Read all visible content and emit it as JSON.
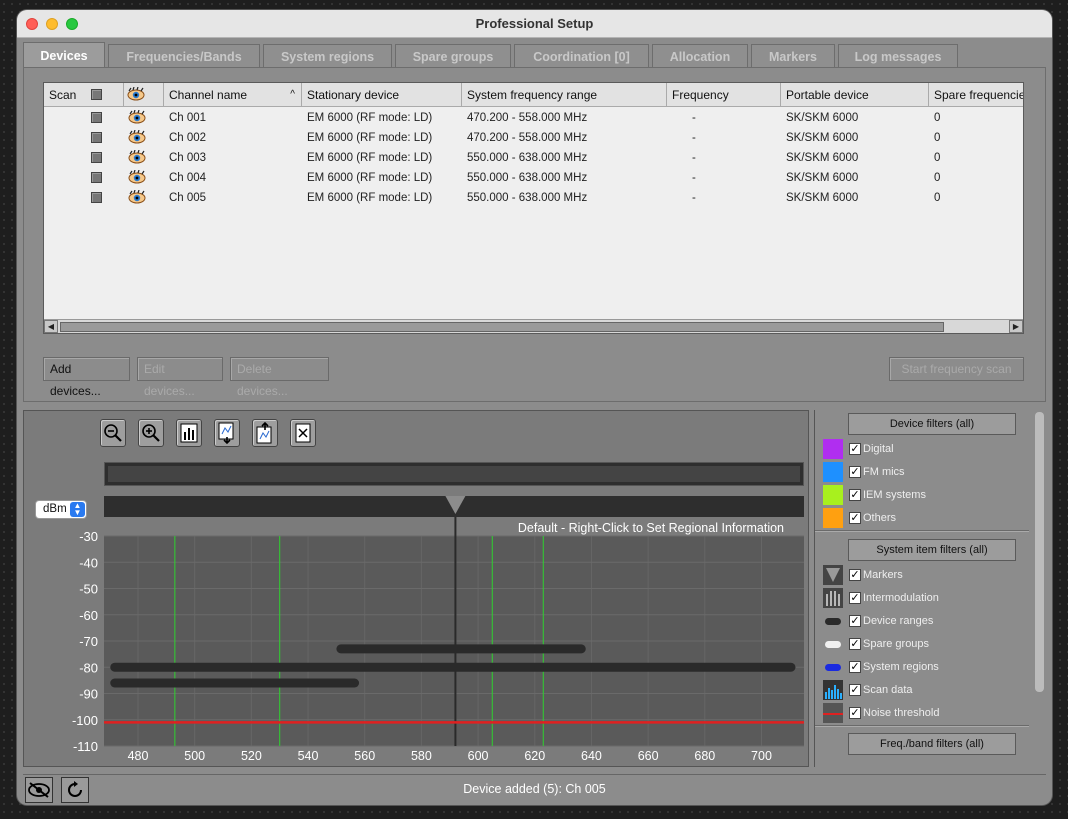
{
  "window": {
    "title": "Professional Setup"
  },
  "tabs": [
    {
      "label": "Devices"
    },
    {
      "label": "Frequencies/Bands"
    },
    {
      "label": "System regions"
    },
    {
      "label": "Spare groups"
    },
    {
      "label": "Coordination [0]"
    },
    {
      "label": "Allocation"
    },
    {
      "label": "Markers"
    },
    {
      "label": "Log messages"
    }
  ],
  "table": {
    "columns": [
      {
        "label": "Scan"
      },
      {
        "label": ""
      },
      {
        "label": "Channel name",
        "sort": "ascending"
      },
      {
        "label": "Stationary device"
      },
      {
        "label": "System frequency range"
      },
      {
        "label": "Frequency"
      },
      {
        "label": "Portable device"
      },
      {
        "label": "Spare frequencie"
      }
    ],
    "rows": [
      {
        "channel": "Ch 001",
        "stationary": "EM 6000 (RF mode: LD)",
        "range": "470.200 - 558.000 MHz",
        "frequency": "-",
        "portable": "SK/SKM 6000",
        "spare": "0"
      },
      {
        "channel": "Ch 002",
        "stationary": "EM 6000 (RF mode: LD)",
        "range": "470.200 - 558.000 MHz",
        "frequency": "-",
        "portable": "SK/SKM 6000",
        "spare": "0"
      },
      {
        "channel": "Ch 003",
        "stationary": "EM 6000 (RF mode: LD)",
        "range": "550.000 - 638.000 MHz",
        "frequency": "-",
        "portable": "SK/SKM 6000",
        "spare": "0"
      },
      {
        "channel": "Ch 004",
        "stationary": "EM 6000 (RF mode: LD)",
        "range": "550.000 - 638.000 MHz",
        "frequency": "-",
        "portable": "SK/SKM 6000",
        "spare": "0"
      },
      {
        "channel": "Ch 005",
        "stationary": "EM 6000 (RF mode: LD)",
        "range": "550.000 - 638.000 MHz",
        "frequency": "-",
        "portable": "SK/SKM 6000",
        "spare": "0"
      }
    ]
  },
  "buttons": {
    "add": "Add devices...",
    "edit": "Edit devices...",
    "delete": "Delete devices...",
    "scan": "Start frequency scan"
  },
  "toolbar": [
    "zoom-out-icon",
    "zoom-in-icon",
    "bar-chart-icon",
    "import-icon",
    "export-icon",
    "clear-icon"
  ],
  "spectrum": {
    "unit": "dBm",
    "region_label": "Default - Right-Click to Set Regional Information",
    "y_ticks": [
      "-30",
      "-40",
      "-50",
      "-60",
      "-70",
      "-80",
      "-90",
      "-100",
      "-110"
    ],
    "x_ticks": [
      "480",
      "500",
      "520",
      "540",
      "560",
      "580",
      "600",
      "620",
      "640",
      "660",
      "680",
      "700"
    ],
    "xlim": [
      468,
      715
    ],
    "ylim": [
      -110,
      -30
    ],
    "green_lines_mhz": [
      493,
      530,
      605,
      623
    ],
    "center_marker_mhz": 592,
    "noise_threshold_dbm": -101,
    "device_ranges": [
      {
        "from": 470.2,
        "to": 558.0,
        "level": -86
      },
      {
        "from": 470.2,
        "to": 712.0,
        "level": -80
      },
      {
        "from": 550.0,
        "to": 638.0,
        "level": -73
      }
    ],
    "colors": {
      "noise": "#e02020",
      "green": "#2fd12f",
      "range": "#2a2a2a"
    }
  },
  "filters": {
    "device_header": "Device filters (all)",
    "device": [
      {
        "label": "Digital",
        "color": "#b02ef0"
      },
      {
        "label": "FM mics",
        "color": "#1e90ff"
      },
      {
        "label": "IEM systems",
        "color": "#a8f01e"
      },
      {
        "label": "Others",
        "color": "#ffa010"
      }
    ],
    "system_header": "System item filters (all)",
    "system": [
      {
        "label": "Markers",
        "icon": "marker-icon"
      },
      {
        "label": "Intermodulation",
        "icon": "intermodulation-icon"
      },
      {
        "label": "Device ranges",
        "icon": "device-range-icon"
      },
      {
        "label": "Spare groups",
        "icon": "spare-group-icon"
      },
      {
        "label": "System regions",
        "icon": "system-region-icon"
      },
      {
        "label": "Scan data",
        "icon": "scan-data-icon"
      },
      {
        "label": "Noise threshold",
        "icon": "noise-threshold-icon"
      }
    ],
    "freq_header": "Freq./band filters (all)"
  },
  "status": {
    "message": "Device added (5): Ch 005"
  }
}
